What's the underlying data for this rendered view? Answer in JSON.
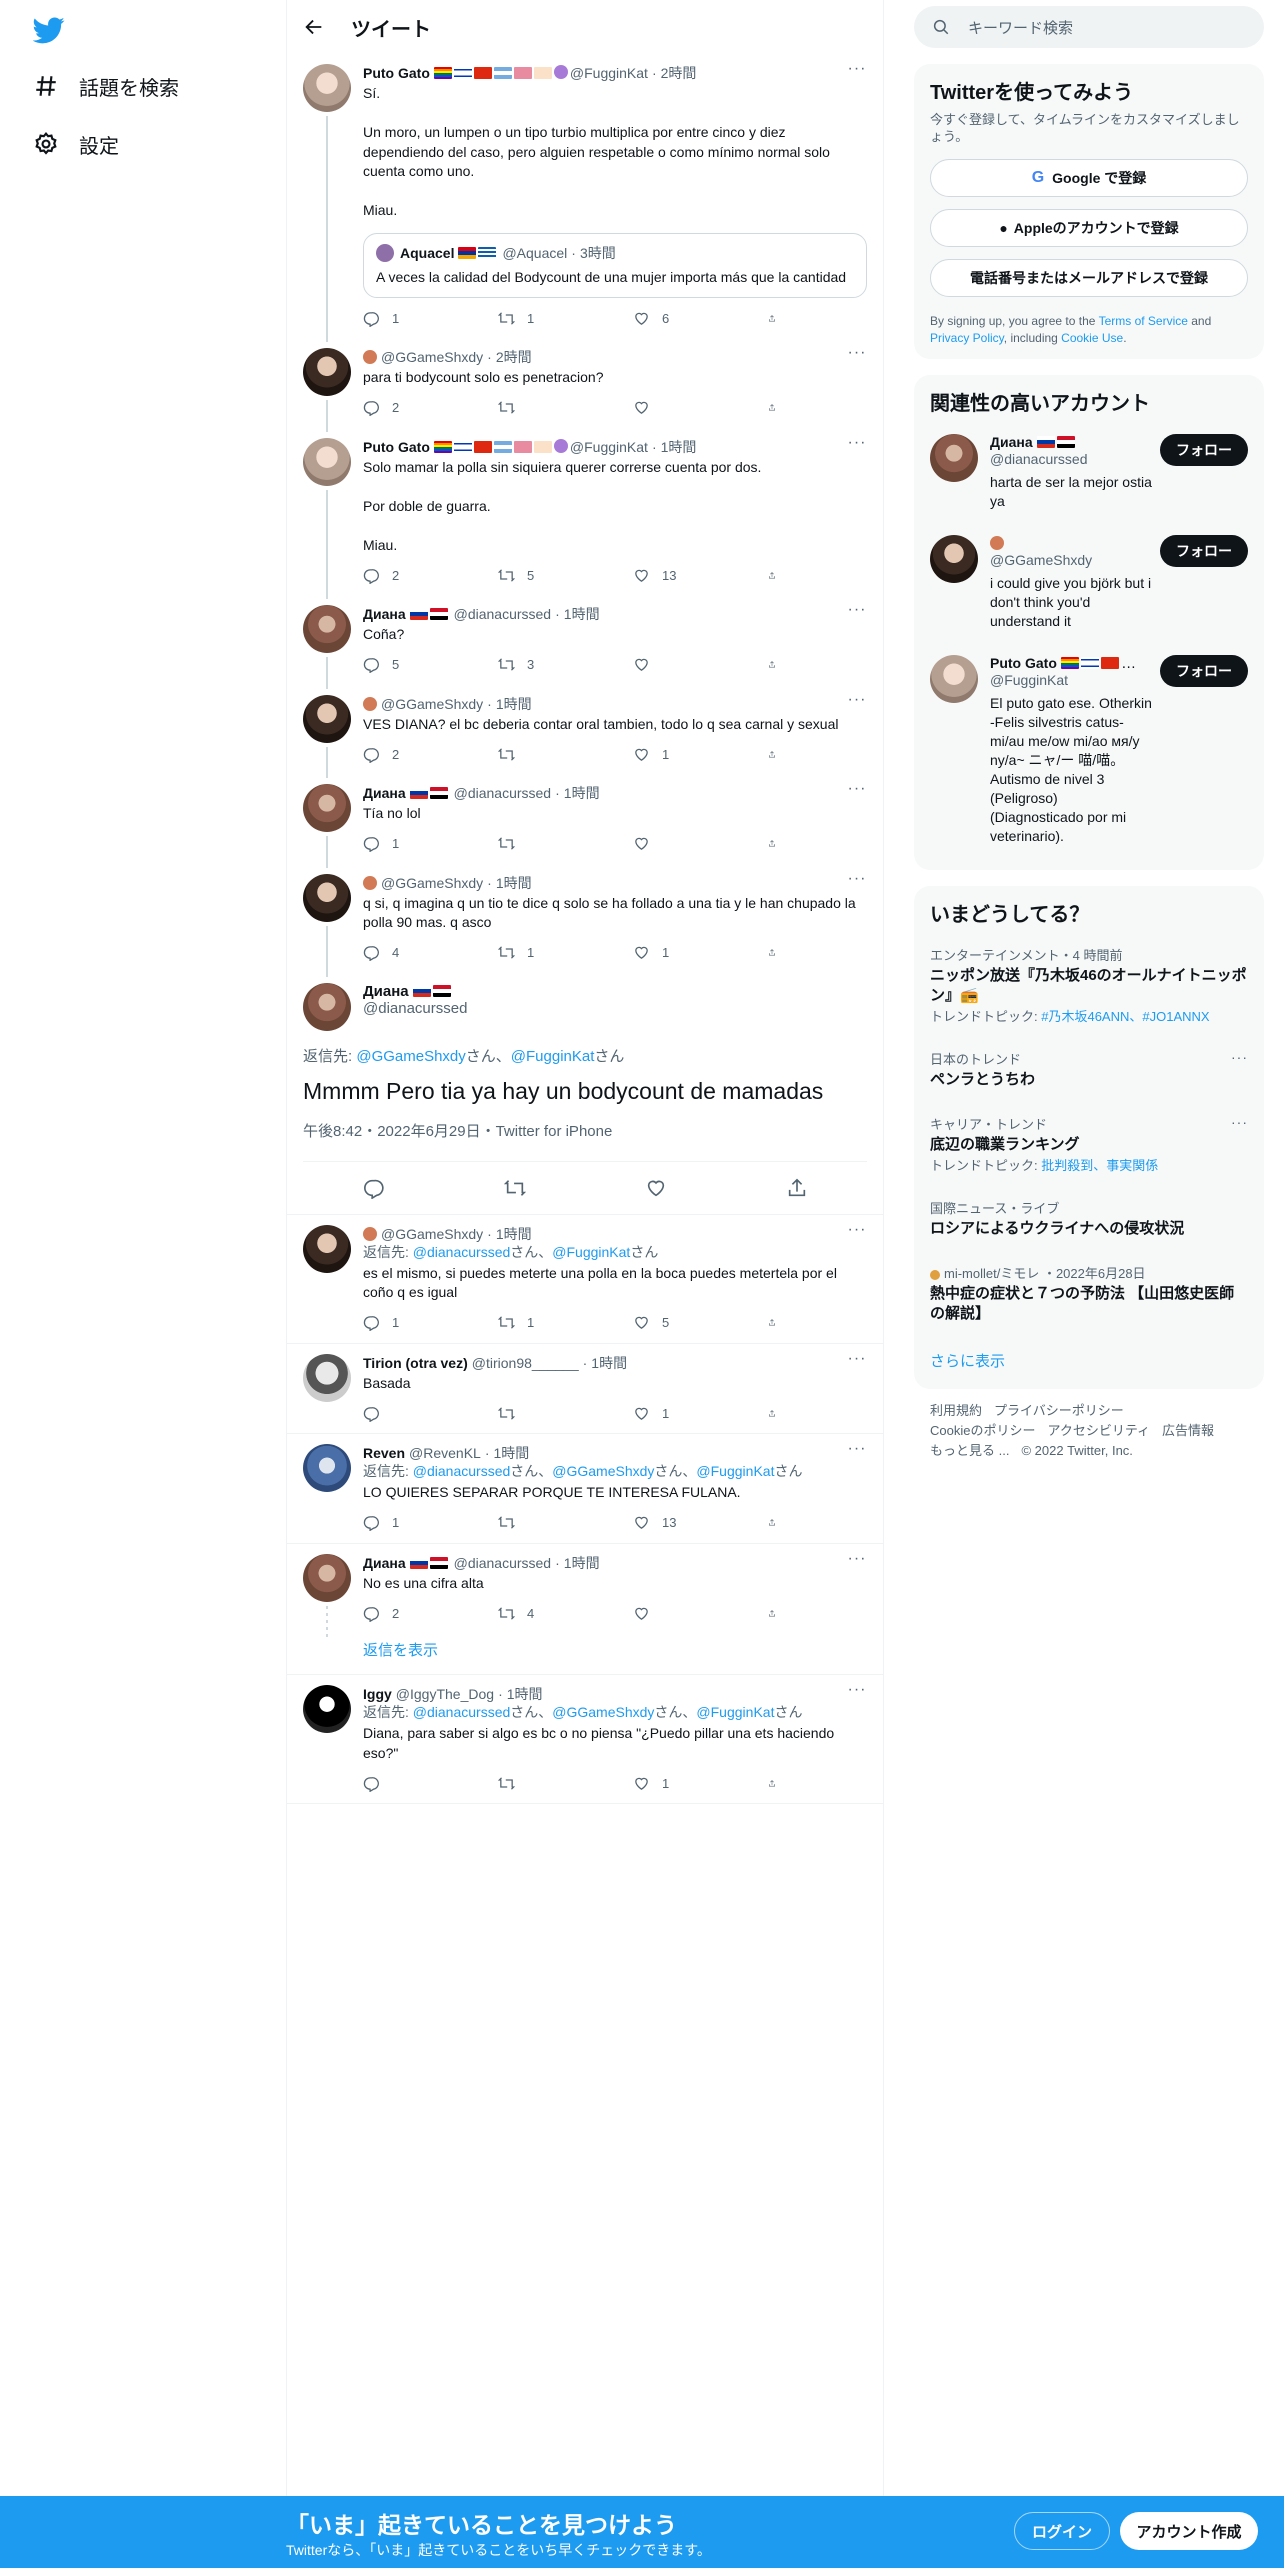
{
  "nav": {
    "explore": "話題を検索",
    "settings": "設定"
  },
  "header": {
    "title": "ツイート"
  },
  "tweets": [
    {
      "name": "Puto Gato",
      "handle": "@FugginKat",
      "time": "2時間",
      "text": "Sí.\n\nUn moro, un lumpen o un tipo turbio multiplica por entre cinco y diez dependiendo del caso, pero alguien respetable o como mínimo normal solo cuenta como uno.\n\nMiau.",
      "quote": {
        "name": "Aquacel",
        "handle": "@Aquacel",
        "time": "3時間",
        "text": "A veces la calidad del Bodycount de una mujer importa más que la cantidad"
      },
      "replies": "1",
      "retweets": "1",
      "likes": "6"
    },
    {
      "name": "",
      "handle": "@GGameShxdy",
      "time": "2時間",
      "text": "para ti bodycount solo es penetracion?",
      "replies": "2",
      "retweets": "",
      "likes": ""
    },
    {
      "name": "Puto Gato",
      "handle": "@FugginKat",
      "time": "1時間",
      "text": "Solo mamar la polla sin siquiera querer correrse cuenta por dos.\n\nPor doble de guarra.\n\nMiau.",
      "replies": "2",
      "retweets": "5",
      "likes": "13"
    },
    {
      "name": "Диана",
      "handle": "@dianacurssed",
      "time": "1時間",
      "text": "Coña?",
      "replies": "5",
      "retweets": "3",
      "likes": ""
    },
    {
      "name": "",
      "handle": "@GGameShxdy",
      "time": "1時間",
      "text": "VES DIANA? el bc deberia contar oral tambien, todo lo q sea carnal y sexual",
      "replies": "2",
      "retweets": "",
      "likes": "1"
    },
    {
      "name": "Диана",
      "handle": "@dianacurssed",
      "time": "1時間",
      "text": "Tía no lol",
      "replies": "1",
      "retweets": "",
      "likes": ""
    },
    {
      "name": "",
      "handle": "@GGameShxdy",
      "time": "1時間",
      "text": "q si, q imagina q un tio te dice q solo se ha follado a una tia y le han chupado la polla 90 mas. q asco",
      "replies": "4",
      "retweets": "1",
      "likes": "1"
    }
  ],
  "focal": {
    "name": "Диана",
    "handle": "@dianacurssed",
    "reply_prefix": "返信先: ",
    "reply_user1": "@GGameShxdy",
    "reply_san1": "さん、",
    "reply_user2": "@FugginKat",
    "reply_san2": "さん",
    "text": "Mmmm Pero tia ya hay un bodycount de mamadas",
    "meta": "午後8:42・2022年6月29日・Twitter for iPhone"
  },
  "replies": [
    {
      "name": "",
      "handle": "@GGameShxdy",
      "time": "1時間",
      "reply_prefix": "返信先: ",
      "reply_user1": "@dianacurssed",
      "reply_san1": "さん、",
      "reply_user2": "@FugginKat",
      "reply_san2": "さん",
      "text": "es el mismo, si puedes meterte una polla en la boca puedes metertela por el coño q es igual",
      "replies": "1",
      "retweets": "1",
      "likes": "5"
    },
    {
      "name": "Tirion (otra vez)",
      "handle": "@tirion98______",
      "time": "1時間",
      "text": "Basada",
      "replies": "",
      "retweets": "",
      "likes": "1"
    },
    {
      "name": "Reven",
      "handle": "@RevenKL",
      "time": "1時間",
      "reply_prefix": "返信先: ",
      "reply_user1": "@dianacurssed",
      "reply_san1": "さん、",
      "reply_user2": "@GGameShxdy",
      "reply_san2": "さん、",
      "reply_user3": "@FugginKat",
      "reply_san3": "さん",
      "text": "LO QUIERES SEPARAR PORQUE TE INTERESA FULANA.",
      "replies": "1",
      "retweets": "",
      "likes": "13"
    },
    {
      "name": "Диана",
      "handle": "@dianacurssed",
      "time": "1時間",
      "text": "No es una cifra alta",
      "replies": "2",
      "retweets": "4",
      "likes": ""
    },
    {
      "name": "Iggy",
      "handle": "@IggyThe_Dog",
      "time": "1時間",
      "reply_prefix": "返信先: ",
      "reply_user1": "@dianacurssed",
      "reply_san1": "さん、",
      "reply_user2": "@GGameShxdy",
      "reply_san2": "さん、",
      "reply_user3": "@FugginKat",
      "reply_san3": "さん",
      "text": "Diana, para saber si algo es bc o no piensa \"¿Puedo pillar una ets haciendo eso?\"",
      "replies": "",
      "retweets": "",
      "likes": "1"
    }
  ],
  "show_replies": "返信を表示",
  "right": {
    "search_placeholder": "キーワード検索",
    "signup": {
      "title": "Twitterを使ってみよう",
      "sub": "今すぐ登録して、タイムラインをカスタマイズしましょう。",
      "google": "Google で登録",
      "apple": "Appleのアカウントで登録",
      "phone": "電話番号またはメールアドレスで登録",
      "legal_1": "By signing up, you agree to the ",
      "terms": "Terms of Service",
      "legal_2": " and ",
      "privacy": "Privacy Policy",
      "legal_3": ", including ",
      "cookie": "Cookie Use",
      "legal_4": "."
    },
    "related": {
      "title": "関連性の高いアカウント",
      "follow": "フォロー",
      "accounts": [
        {
          "name": "Диана",
          "handle": "@dianacurssed",
          "bio": "harta de ser la mejor ostia ya"
        },
        {
          "name": "",
          "handle": "@GGameShxdy",
          "bio": "i could give you björk but i don't think you'd understand it"
        },
        {
          "name": "Puto Gato",
          "handle": "@FugginKat",
          "bio": "El puto gato ese. Otherkin -Felis silvestris catus- mi/au me/ow mi/ao мя/у ny/a~ ニャ/ー 喵/喵。 Autismo de nivel 3 (Peligroso) (Diagnosticado por mi veterinario)."
        }
      ]
    },
    "trends": {
      "title": "いまどうしてる？",
      "items": [
        {
          "cat": "エンターテインメント・4 時間前",
          "title": "ニッポン放送『乃木坂46のオールナイトニッポン』📻",
          "tt_prefix": "トレンドトピック: ",
          "tt": "#乃木坂46ANN、#JO1ANNX"
        },
        {
          "cat": "日本のトレンド",
          "title": "ペンラとうちわ",
          "tt_prefix": "",
          "tt": ""
        },
        {
          "cat": "キャリア・トレンド",
          "title": "底辺の職業ランキング",
          "tt_prefix": "トレンドトピック: ",
          "tt": "批判殺到、事実関係"
        },
        {
          "cat": "国際ニュース・ライブ",
          "title": "ロシアによるウクライナへの侵攻状況",
          "tt_prefix": "",
          "tt": ""
        },
        {
          "cat": "mi-mollet/ミモレ ・2022年6月28日",
          "title": "熱中症の症状と７つの予防法 【山田悠史医師の解説】",
          "tt_prefix": "",
          "tt": ""
        }
      ],
      "more": "さらに表示"
    },
    "footer": {
      "terms": "利用規約",
      "privacy": "プライバシーポリシー",
      "cookie": "Cookieのポリシー",
      "accessibility": "アクセシビリティ",
      "ads": "広告情報",
      "more": "もっと見る ...",
      "copyright": "© 2022 Twitter, Inc."
    }
  },
  "banner": {
    "title": "「いま」起きていることを見つけよう",
    "sub": "Twitterなら、「いま」起きていることをいち早くチェックできます。",
    "login": "ログイン",
    "signup": "アカウント作成"
  },
  "colors": {
    "accent": "#1d9bf0",
    "text": "#0f1419",
    "muted": "#536471"
  }
}
